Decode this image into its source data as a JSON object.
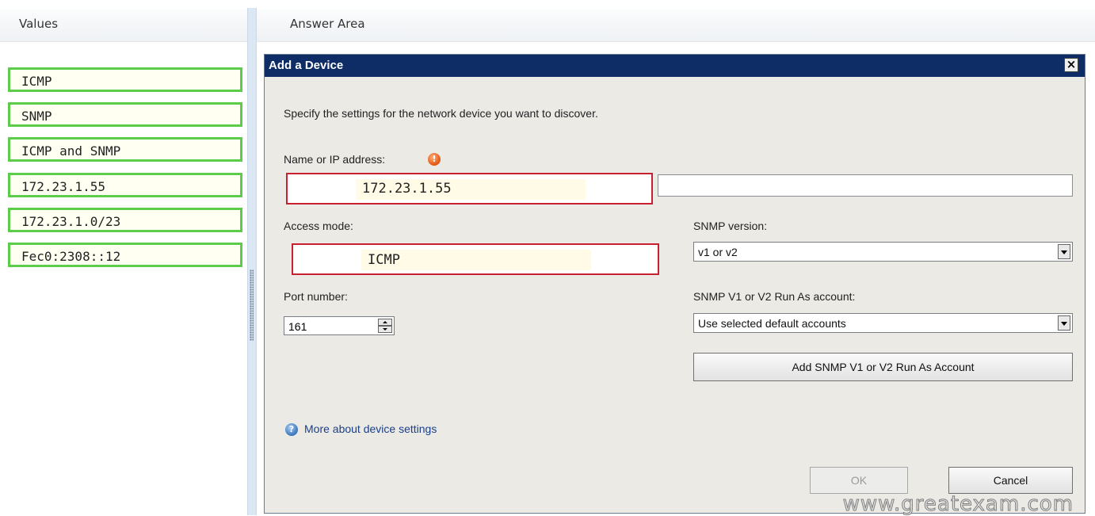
{
  "values_panel": {
    "header": "Values",
    "items": [
      "ICMP",
      "SNMP",
      "ICMP and SNMP",
      "172.23.1.55",
      "172.23.1.0/23",
      "Fec0:2308::12"
    ]
  },
  "answer_panel": {
    "header": "Answer Area"
  },
  "dialog": {
    "title": "Add a Device",
    "close_glyph": "×",
    "instruction": "Specify the settings for the network device you want to discover.",
    "name_label": "Name or IP address:",
    "name_warning_icon": "warning-icon",
    "name_value": "172.23.1.55",
    "access_label": "Access mode:",
    "access_value": "ICMP",
    "snmp_version_label": "SNMP version:",
    "snmp_version_value": "v1 or v2",
    "port_label": "Port number:",
    "port_value": "161",
    "run_as_label": "SNMP V1 or V2 Run As account:",
    "run_as_value": "Use selected default accounts",
    "add_account_button": "Add SNMP V1 or V2 Run As Account",
    "help_icon": "help-icon",
    "help_link": "More about device settings",
    "ok_button": "OK",
    "cancel_button": "Cancel"
  },
  "watermark": "www.greatexam.com",
  "colors": {
    "tile_border": "#5ccc4a",
    "target_border": "#c82030",
    "titlebar": "#0e2c66",
    "dialog_bg": "#eceae5"
  }
}
